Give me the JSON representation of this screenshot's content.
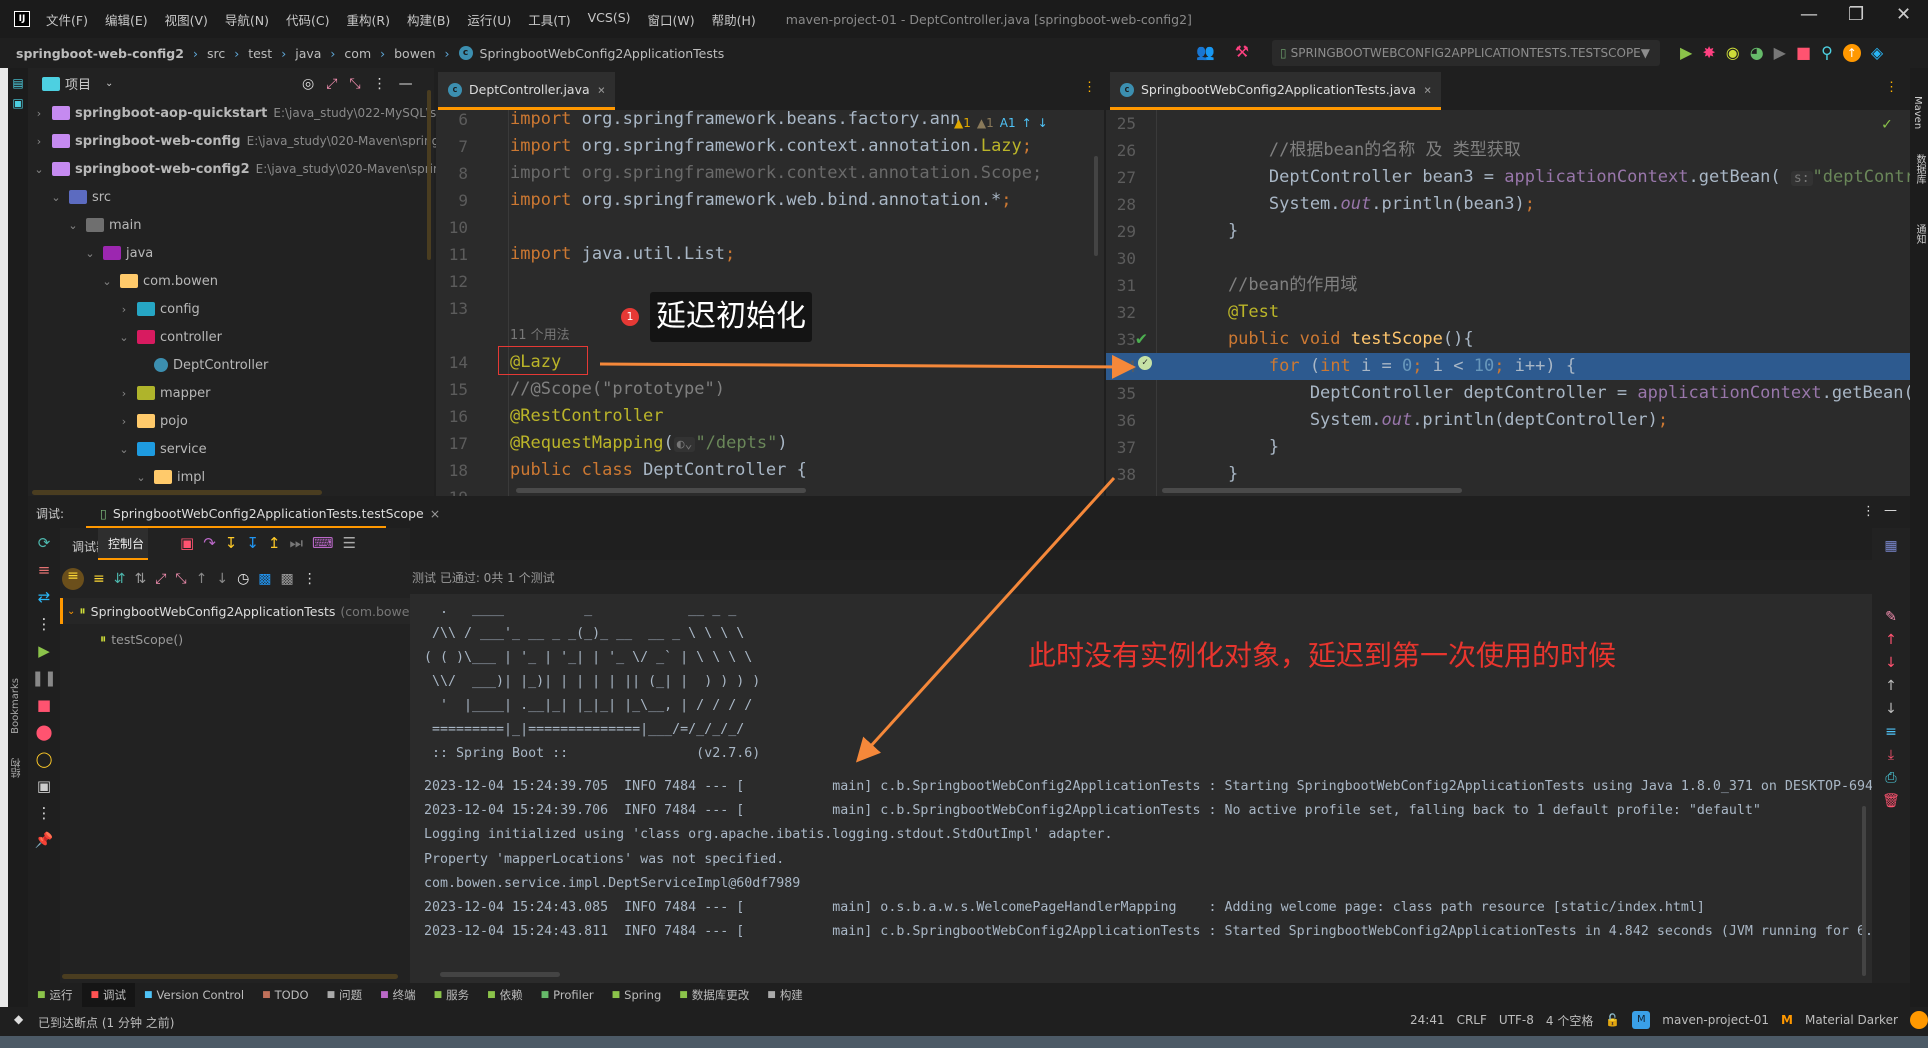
{
  "titlebar": {
    "menu": [
      "文件(F)",
      "编辑(E)",
      "视图(V)",
      "导航(N)",
      "代码(C)",
      "重构(R)",
      "构建(B)",
      "运行(U)",
      "工具(T)",
      "VCS(S)",
      "窗口(W)",
      "帮助(H)"
    ],
    "title": "maven-project-01 - DeptController.java [springboot-web-config2]"
  },
  "navbar": {
    "crumbs": [
      "springboot-web-config2",
      "src",
      "test",
      "java",
      "com",
      "bowen",
      "SpringbootWebConfig2ApplicationTests"
    ],
    "run_config": "SPRINGBOOTWEBCONFIG2APPLICATIONTESTS.TESTSCOPE"
  },
  "project": {
    "title": "项目",
    "items": [
      {
        "label": "springboot-aop-quickstart",
        "path": "E:\\java_study\\022-MySQL\\springb",
        "depth": 0,
        "open": false,
        "icon": "module",
        "color": "#c58af0"
      },
      {
        "label": "springboot-web-config",
        "path": "E:\\java_study\\020-Maven\\springboot",
        "depth": 0,
        "open": false,
        "icon": "module",
        "color": "#c58af0"
      },
      {
        "label": "springboot-web-config2",
        "path": "E:\\java_study\\020-Maven\\springboo",
        "depth": 0,
        "open": true,
        "icon": "module",
        "color": "#c58af0"
      },
      {
        "label": "src",
        "depth": 1,
        "open": true,
        "icon": "source-folder",
        "color": "#5c6bc0"
      },
      {
        "label": "main",
        "depth": 2,
        "open": true,
        "icon": "folder",
        "color": "#6f6f6f"
      },
      {
        "label": "java",
        "depth": 3,
        "open": true,
        "icon": "java-folder",
        "color": "#9c27b0"
      },
      {
        "label": "com.bowen",
        "depth": 4,
        "open": true,
        "icon": "package",
        "color": "#ffca6b"
      },
      {
        "label": "config",
        "depth": 5,
        "open": false,
        "icon": "config-folder",
        "color": "#26a6c4"
      },
      {
        "label": "controller",
        "depth": 5,
        "open": true,
        "icon": "controller-folder",
        "color": "#d81b60"
      },
      {
        "label": "DeptController",
        "depth": 6,
        "leaf": true,
        "icon": "class",
        "color": "#3c8fb0"
      },
      {
        "label": "mapper",
        "depth": 5,
        "open": false,
        "icon": "mapper-folder",
        "color": "#afb42b"
      },
      {
        "label": "pojo",
        "depth": 5,
        "open": false,
        "icon": "package",
        "color": "#ffca6b"
      },
      {
        "label": "service",
        "depth": 5,
        "open": true,
        "icon": "service-folder",
        "color": "#1e9be0"
      },
      {
        "label": "impl",
        "depth": 6,
        "open": true,
        "icon": "package",
        "color": "#ffca6b"
      }
    ]
  },
  "editor_left": {
    "tab": "DeptController.java",
    "inspection": {
      "warnings": "1",
      "weak_warnings": "1",
      "typos": "1"
    },
    "usages_hint": "11 个用法",
    "lines": [
      {
        "n": "6",
        "t": [
          [
            "import",
            "kw"
          ],
          [
            " org.springframework.beans.factory.ann",
            "pl"
          ]
        ]
      },
      {
        "n": "7",
        "t": [
          [
            "import",
            "kw"
          ],
          [
            " org.springframework.context.annotation.",
            "pl"
          ],
          [
            "Lazy",
            "an"
          ],
          [
            ";",
            "kw"
          ]
        ]
      },
      {
        "n": "8",
        "t": [
          [
            "import org.springframework.context.annotation.Scope;",
            "gr"
          ]
        ]
      },
      {
        "n": "9",
        "t": [
          [
            "import",
            "kw"
          ],
          [
            " org.springframework.web.bind.annotation.*",
            "pl"
          ],
          [
            ";",
            "kw"
          ]
        ]
      },
      {
        "n": "10",
        "t": []
      },
      {
        "n": "11",
        "t": [
          [
            "import",
            "kw"
          ],
          [
            " java.util.List",
            "pl"
          ],
          [
            ";",
            "kw"
          ]
        ]
      },
      {
        "n": "12",
        "t": []
      },
      {
        "n": "13",
        "t": []
      },
      {
        "n": "14",
        "t": [
          [
            "@Lazy",
            "an"
          ]
        ]
      },
      {
        "n": "15",
        "t": [
          [
            "//@Scope(\"prototype\")",
            "cm"
          ]
        ]
      },
      {
        "n": "16",
        "t": [
          [
            "@RestController",
            "an"
          ]
        ]
      },
      {
        "n": "17",
        "t": [
          [
            "@RequestMapping",
            "an"
          ],
          [
            "(",
            "pl"
          ],
          [
            "◐⌄",
            "hint"
          ],
          [
            "\"/depts\"",
            "st"
          ],
          [
            ")",
            "pl"
          ]
        ]
      },
      {
        "n": "18",
        "t": [
          [
            "public class ",
            "kw"
          ],
          [
            "DeptController {",
            "pl"
          ]
        ]
      },
      {
        "n": "19",
        "t": []
      }
    ]
  },
  "editor_right": {
    "tab": "SpringbootWebConfig2ApplicationTests.java",
    "lines": [
      {
        "n": "25",
        "t": []
      },
      {
        "n": "26",
        "t": [
          [
            "        //根据bean的名称 及 类型获取",
            "cm"
          ]
        ]
      },
      {
        "n": "27",
        "t": [
          [
            "        DeptController bean3 = ",
            "pl"
          ],
          [
            "applicationContext",
            "fd"
          ],
          [
            ".getBean( ",
            "pl"
          ],
          [
            "s:",
            "hint"
          ],
          [
            "\"deptControl",
            "st"
          ]
        ]
      },
      {
        "n": "28",
        "t": [
          [
            "        System.",
            "pl"
          ],
          [
            "out",
            "fd it"
          ],
          [
            ".println(bean3)",
            "pl"
          ],
          [
            ";",
            "kw"
          ]
        ]
      },
      {
        "n": "29",
        "t": [
          [
            "    }",
            "pl"
          ]
        ]
      },
      {
        "n": "30",
        "t": []
      },
      {
        "n": "31",
        "t": [
          [
            "    //bean的作用域",
            "cm"
          ]
        ]
      },
      {
        "n": "32",
        "t": [
          [
            "    @Test",
            "an"
          ]
        ]
      },
      {
        "n": "33",
        "t": [
          [
            "    public void ",
            "kw"
          ],
          [
            "testScope",
            "mt"
          ],
          [
            "(){",
            "pl"
          ]
        ]
      },
      {
        "n": "34",
        "t": [
          [
            "        for ",
            "kw"
          ],
          [
            "(",
            "pl"
          ],
          [
            "int ",
            "kw"
          ],
          [
            "i",
            "pl"
          ],
          [
            " = ",
            "pl"
          ],
          [
            "0",
            "nm"
          ],
          [
            "; ",
            "kw"
          ],
          [
            "i",
            "pl"
          ],
          [
            " < ",
            "pl"
          ],
          [
            "10",
            "nm"
          ],
          [
            "; ",
            "kw"
          ],
          [
            "i++) {",
            "pl"
          ]
        ],
        "current": true
      },
      {
        "n": "35",
        "t": [
          [
            "            DeptController deptController = ",
            "pl"
          ],
          [
            "applicationContext",
            "fd"
          ],
          [
            ".getBean(D",
            "pl"
          ]
        ]
      },
      {
        "n": "36",
        "t": [
          [
            "            System.",
            "pl"
          ],
          [
            "out",
            "fd it"
          ],
          [
            ".println(deptController)",
            "pl"
          ],
          [
            ";",
            "kw"
          ]
        ]
      },
      {
        "n": "37",
        "t": [
          [
            "        }",
            "pl"
          ]
        ]
      },
      {
        "n": "38",
        "t": [
          [
            "    }",
            "pl"
          ]
        ]
      }
    ]
  },
  "debug": {
    "label": "调试:",
    "session_tab": "SpringbootWebConfig2ApplicationTests.testScope",
    "tabs": [
      "调试器",
      "控制台"
    ],
    "active_tab": "控制台",
    "test_status": "测试 已通过: 0共 1 个测试",
    "tests": [
      {
        "label": "SpringbootWebConfig2ApplicationTests",
        "suffix": "(com.bowen"
      },
      {
        "label": "testScope()"
      }
    ]
  },
  "console": {
    "banner": [
      "  .   ____          _            __ _ _",
      " /\\\\ / ___'_ __ _ _(_)_ __  __ _ \\ \\ \\ \\",
      "( ( )\\___ | '_ | '_| | '_ \\/ _` | \\ \\ \\ \\",
      " \\\\/  ___)| |_)| | | | | || (_| |  ) ) ) )",
      "  '  |____| .__|_| |_|_| |_\\__, | / / / /",
      " =========|_|==============|___/=/_/_/_/",
      " :: Spring Boot ::                (v2.7.6)"
    ],
    "lines": [
      "2023-12-04 15:24:39.705  INFO 7484 --- [           main] c.b.SpringbootWebConfig2ApplicationTests : Starting SpringbootWebConfig2ApplicationTests using Java 1.8.0_371 on DESKTOP-694C",
      "2023-12-04 15:24:39.706  INFO 7484 --- [           main] c.b.SpringbootWebConfig2ApplicationTests : No active profile set, falling back to 1 default profile: \"default\"",
      "Logging initialized using 'class org.apache.ibatis.logging.stdout.StdOutImpl' adapter.",
      "Property 'mapperLocations' was not specified.",
      "com.bowen.service.impl.DeptServiceImpl@60df7989",
      "2023-12-04 15:24:43.085  INFO 7484 --- [           main] o.s.b.a.w.s.WelcomePageHandlerMapping    : Adding welcome page: class path resource [static/index.html]",
      "2023-12-04 15:24:43.811  INFO 7484 --- [           main] c.b.SpringbootWebConfig2ApplicationTests : Started SpringbootWebConfig2ApplicationTests in 4.842 seconds (JVM running for 6.6"
    ]
  },
  "annotations": {
    "badge": "1",
    "label": "延迟初始化",
    "note": "此时没有实例化对象，延迟到第一次使用的时候",
    "arrow_color": "#f5883a",
    "note_color": "#e8352e"
  },
  "bottom_tools": [
    {
      "label": "运行",
      "icon": "run-icon",
      "color": "#8bc34a"
    },
    {
      "label": "调试",
      "icon": "debug-icon",
      "color": "#ff5252",
      "active": true
    },
    {
      "label": "Version Control",
      "icon": "vcs-icon",
      "color": "#4fc3f7"
    },
    {
      "label": "TODO",
      "icon": "todo-icon",
      "color": "#c0705a"
    },
    {
      "label": "问题",
      "icon": "problems-icon",
      "color": "#aaa"
    },
    {
      "label": "终端",
      "icon": "terminal-icon",
      "color": "#ba68c8"
    },
    {
      "label": "服务",
      "icon": "services-icon",
      "color": "#8bc34a"
    },
    {
      "label": "依赖",
      "icon": "dependencies-icon",
      "color": "#8bc34a"
    },
    {
      "label": "Profiler",
      "icon": "profiler-icon",
      "color": "#66bb6a"
    },
    {
      "label": "Spring",
      "icon": "spring-icon",
      "color": "#8bc34a"
    },
    {
      "label": "数据库更改",
      "icon": "database-changes-icon",
      "color": "#8bc34a"
    },
    {
      "label": "构建",
      "icon": "build-icon",
      "color": "#aaa"
    }
  ],
  "status": {
    "message": "已到达断点 (1 分钟 之前)",
    "position": "24:41",
    "line_sep": "CRLF",
    "encoding": "UTF-8",
    "indent": "4 个空格",
    "project": "maven-project-01",
    "project_badge": "M",
    "theme": "Material Darker"
  },
  "side_labels": {
    "right": [
      "Maven",
      "数据库",
      "通知"
    ],
    "left": [
      "项目",
      "Bookmarks",
      "结构"
    ]
  }
}
